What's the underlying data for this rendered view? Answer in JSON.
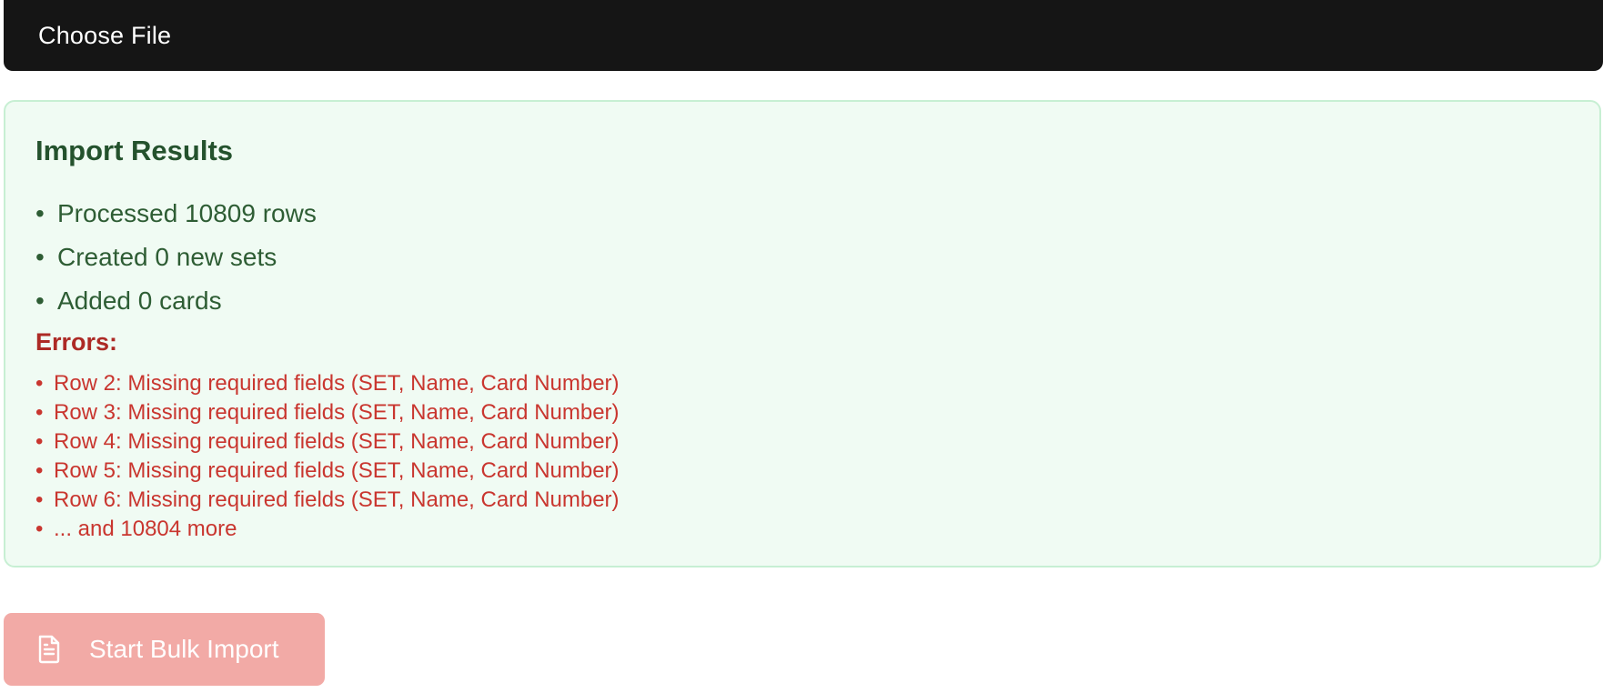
{
  "file_picker": {
    "label": "Choose File"
  },
  "results": {
    "title": "Import Results",
    "summary": [
      "Processed 10809 rows",
      "Created 0 new sets",
      "Added 0 cards"
    ],
    "errors_heading": "Errors:",
    "errors": [
      "Row 2: Missing required fields (SET, Name, Card Number)",
      "Row 3: Missing required fields (SET, Name, Card Number)",
      "Row 4: Missing required fields (SET, Name, Card Number)",
      "Row 5: Missing required fields (SET, Name, Card Number)",
      "Row 6: Missing required fields (SET, Name, Card Number)",
      "... and 10804 more"
    ],
    "bullet": "•"
  },
  "import_button": {
    "label": "Start Bulk Import",
    "icon": "document-icon"
  },
  "colors": {
    "file_bar_bg": "#151515",
    "results_bg": "#f0fbf3",
    "results_border": "#c7efd3",
    "success_text": "#2e5d34",
    "error_heading": "#ad2a25",
    "error_text": "#c9362f",
    "button_bg": "#f2aaa6"
  }
}
